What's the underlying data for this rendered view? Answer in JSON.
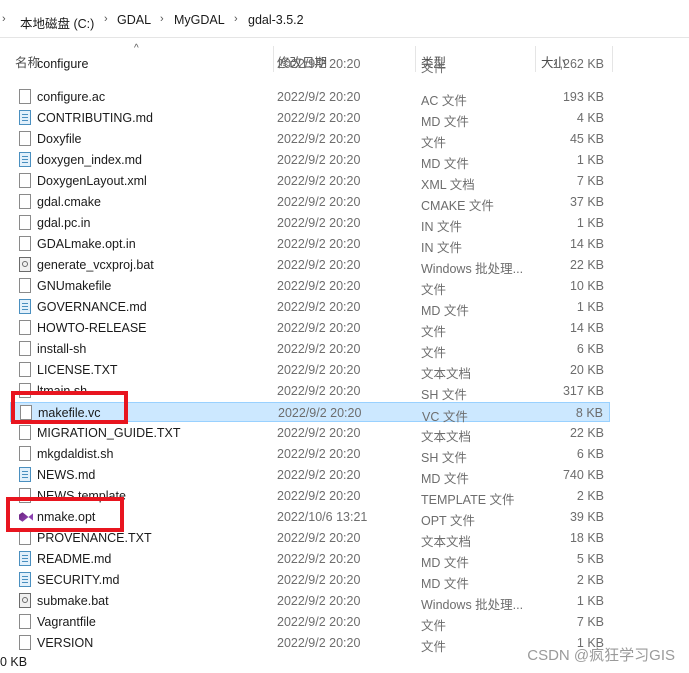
{
  "breadcrumb": {
    "items": [
      "本地磁盘 (C:)",
      "GDAL",
      "MyGDAL",
      "gdal-3.5.2"
    ],
    "separator": "›"
  },
  "columns": {
    "name": "名称",
    "date": "修改日期",
    "type": "类型",
    "size": "大小"
  },
  "files": [
    {
      "name": "configure",
      "date": "2022/9/2 20:20",
      "type": "文件",
      "size": "1,262 KB",
      "icon": "file-icon"
    },
    {
      "name": "configure.ac",
      "date": "2022/9/2 20:20",
      "type": "AC 文件",
      "size": "193 KB",
      "icon": "file-icon"
    },
    {
      "name": "CONTRIBUTING.md",
      "date": "2022/9/2 20:20",
      "type": "MD 文件",
      "size": "4 KB",
      "icon": "md-file-icon"
    },
    {
      "name": "Doxyfile",
      "date": "2022/9/2 20:20",
      "type": "文件",
      "size": "45 KB",
      "icon": "file-icon"
    },
    {
      "name": "doxygen_index.md",
      "date": "2022/9/2 20:20",
      "type": "MD 文件",
      "size": "1 KB",
      "icon": "md-file-icon"
    },
    {
      "name": "DoxygenLayout.xml",
      "date": "2022/9/2 20:20",
      "type": "XML 文档",
      "size": "7 KB",
      "icon": "file-icon"
    },
    {
      "name": "gdal.cmake",
      "date": "2022/9/2 20:20",
      "type": "CMAKE 文件",
      "size": "37 KB",
      "icon": "file-icon"
    },
    {
      "name": "gdal.pc.in",
      "date": "2022/9/2 20:20",
      "type": "IN 文件",
      "size": "1 KB",
      "icon": "file-icon"
    },
    {
      "name": "GDALmake.opt.in",
      "date": "2022/9/2 20:20",
      "type": "IN 文件",
      "size": "14 KB",
      "icon": "file-icon"
    },
    {
      "name": "generate_vcxproj.bat",
      "date": "2022/9/2 20:20",
      "type": "Windows 批处理...",
      "size": "22 KB",
      "icon": "batch-file-icon"
    },
    {
      "name": "GNUmakefile",
      "date": "2022/9/2 20:20",
      "type": "文件",
      "size": "10 KB",
      "icon": "file-icon"
    },
    {
      "name": "GOVERNANCE.md",
      "date": "2022/9/2 20:20",
      "type": "MD 文件",
      "size": "1 KB",
      "icon": "md-file-icon"
    },
    {
      "name": "HOWTO-RELEASE",
      "date": "2022/9/2 20:20",
      "type": "文件",
      "size": "14 KB",
      "icon": "file-icon"
    },
    {
      "name": "install-sh",
      "date": "2022/9/2 20:20",
      "type": "文件",
      "size": "6 KB",
      "icon": "file-icon"
    },
    {
      "name": "LICENSE.TXT",
      "date": "2022/9/2 20:20",
      "type": "文本文档",
      "size": "20 KB",
      "icon": "file-icon"
    },
    {
      "name": "ltmain.sh",
      "date": "2022/9/2 20:20",
      "type": "SH 文件",
      "size": "317 KB",
      "icon": "file-icon"
    },
    {
      "name": "makefile.vc",
      "date": "2022/9/2 20:20",
      "type": "VC 文件",
      "size": "8 KB",
      "icon": "file-icon",
      "selected": true
    },
    {
      "name": "MIGRATION_GUIDE.TXT",
      "date": "2022/9/2 20:20",
      "type": "文本文档",
      "size": "22 KB",
      "icon": "file-icon"
    },
    {
      "name": "mkgdaldist.sh",
      "date": "2022/9/2 20:20",
      "type": "SH 文件",
      "size": "6 KB",
      "icon": "file-icon"
    },
    {
      "name": "NEWS.md",
      "date": "2022/9/2 20:20",
      "type": "MD 文件",
      "size": "740 KB",
      "icon": "md-file-icon"
    },
    {
      "name": "NEWS.template",
      "date": "2022/9/2 20:20",
      "type": "TEMPLATE 文件",
      "size": "2 KB",
      "icon": "file-icon"
    },
    {
      "name": "nmake.opt",
      "date": "2022/10/6 13:21",
      "type": "OPT 文件",
      "size": "39 KB",
      "icon": "visual-studio-icon"
    },
    {
      "name": "PROVENANCE.TXT",
      "date": "2022/9/2 20:20",
      "type": "文本文档",
      "size": "18 KB",
      "icon": "file-icon"
    },
    {
      "name": "README.md",
      "date": "2022/9/2 20:20",
      "type": "MD 文件",
      "size": "5 KB",
      "icon": "md-file-icon"
    },
    {
      "name": "SECURITY.md",
      "date": "2022/9/2 20:20",
      "type": "MD 文件",
      "size": "2 KB",
      "icon": "md-file-icon"
    },
    {
      "name": "submake.bat",
      "date": "2022/9/2 20:20",
      "type": "Windows 批处理...",
      "size": "1 KB",
      "icon": "batch-file-icon"
    },
    {
      "name": "Vagrantfile",
      "date": "2022/9/2 20:20",
      "type": "文件",
      "size": "7 KB",
      "icon": "file-icon"
    },
    {
      "name": "VERSION",
      "date": "2022/9/2 20:20",
      "type": "文件",
      "size": "1 KB",
      "icon": "file-icon"
    }
  ],
  "status": {
    "size_text": "0 KB"
  },
  "watermark": "CSDN @疯狂学习GIS",
  "colors": {
    "selection_bg": "#cce8ff",
    "selection_border": "#99d1ff",
    "highlight_box": "#e8151f"
  }
}
